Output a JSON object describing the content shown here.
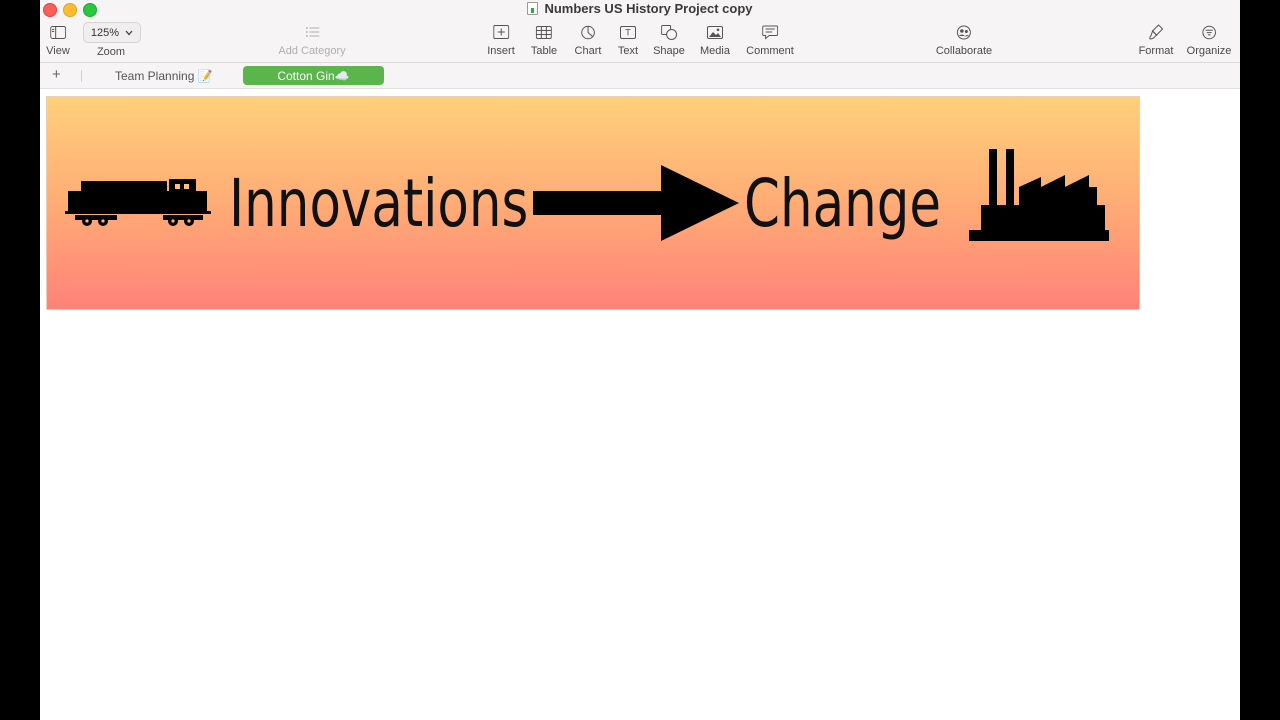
{
  "window": {
    "title": "Numbers US History Project copy"
  },
  "toolbar": {
    "view_label": "View",
    "zoom_value": "125%",
    "zoom_label": "Zoom",
    "add_category_label": "Add Category",
    "insert_label": "Insert",
    "table_label": "Table",
    "chart_label": "Chart",
    "text_label": "Text",
    "shape_label": "Shape",
    "media_label": "Media",
    "comment_label": "Comment",
    "collaborate_label": "Collaborate",
    "format_label": "Format",
    "organize_label": "Organize"
  },
  "sheets": {
    "add_symbol": "+",
    "tabs": [
      {
        "label": "Team Planning 📝",
        "active": false
      },
      {
        "label": "Cotton Gin☁️",
        "active": true
      }
    ]
  },
  "banner": {
    "word_left": "Innovations",
    "word_right": "Change",
    "icons": [
      "train-icon",
      "arrow-right-icon",
      "factory-icon"
    ]
  },
  "colors": {
    "active_tab": "#5ab64a",
    "banner_top": "#ffd07a",
    "banner_bottom": "#ff8278"
  }
}
